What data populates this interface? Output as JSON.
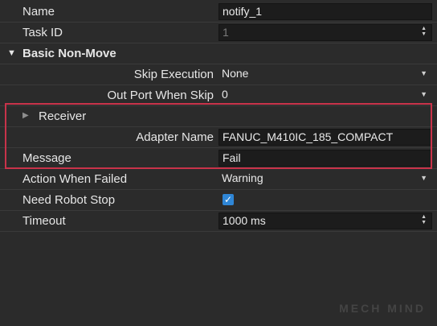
{
  "properties": {
    "name": {
      "label": "Name",
      "value": "notify_1"
    },
    "task_id": {
      "label": "Task ID",
      "value": "1"
    },
    "section": {
      "label": "Basic Non-Move",
      "toggle_icon": "triangle-down-icon"
    },
    "skip_execution": {
      "label": "Skip Execution",
      "value": "None"
    },
    "out_port": {
      "label": "Out Port When Skip",
      "value": "0"
    },
    "receiver": {
      "label": "Receiver",
      "toggle_icon": "triangle-right-icon"
    },
    "adapter_name": {
      "label": "Adapter Name",
      "value": "FANUC_M410IC_185_COMPACT"
    },
    "message": {
      "label": "Message",
      "value": "Fail"
    },
    "action_when_failed": {
      "label": "Action When Failed",
      "value": "Warning"
    },
    "need_robot_stop": {
      "label": "Need Robot Stop",
      "checked": true
    },
    "timeout": {
      "label": "Timeout",
      "value": "1000 ms"
    }
  },
  "watermark": "MECH MIND",
  "colors": {
    "highlight": "#c8334a",
    "checkbox": "#2f86d6",
    "background": "#2b2b2b"
  }
}
